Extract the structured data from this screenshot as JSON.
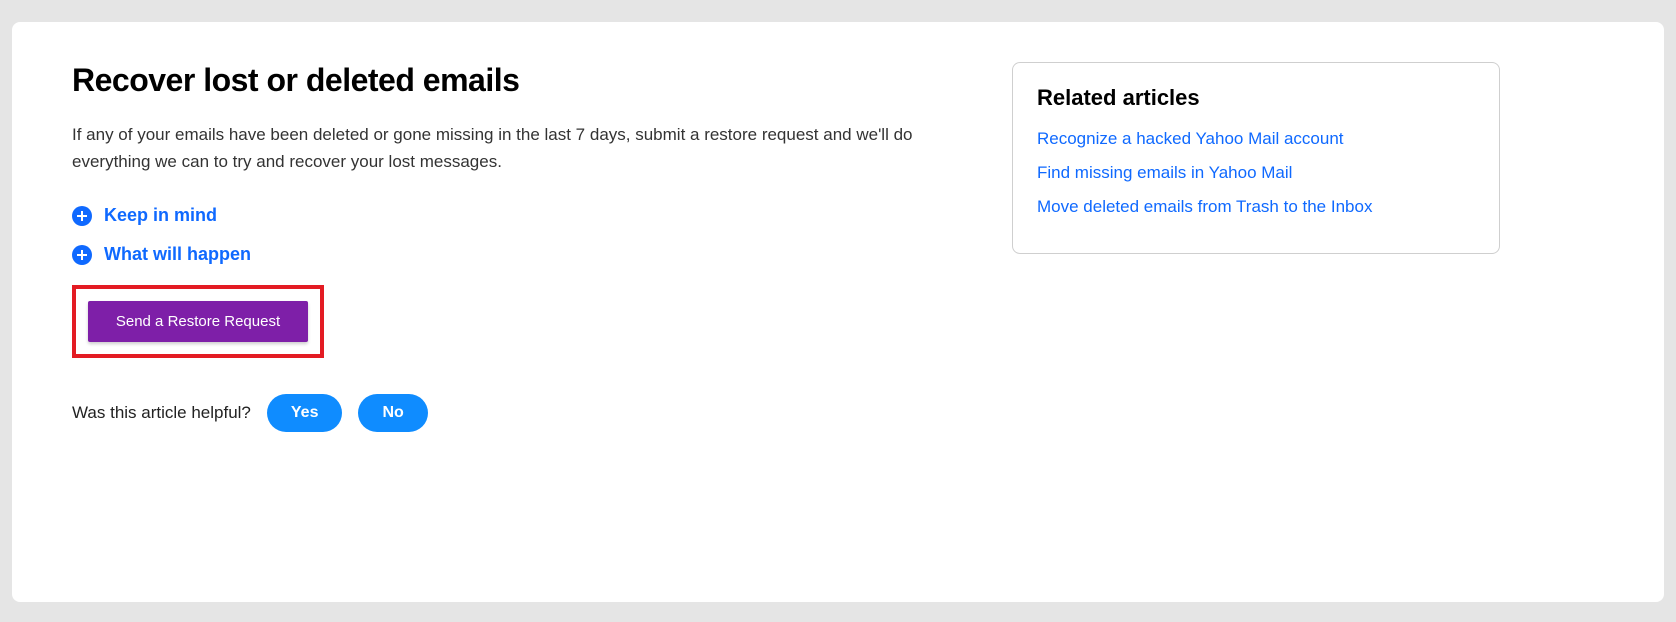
{
  "main": {
    "title": "Recover lost or deleted emails",
    "intro": "If any of your emails have been deleted or gone missing in the last 7 days, submit a restore request and we'll do everything we can to try and recover your lost messages.",
    "expanders": [
      {
        "label": "Keep in mind"
      },
      {
        "label": "What will happen"
      }
    ],
    "restore_button": "Send a Restore Request",
    "feedback_prompt": "Was this article helpful?",
    "yes_label": "Yes",
    "no_label": "No"
  },
  "sidebar": {
    "related_title": "Related articles",
    "links": [
      {
        "text": "Recognize a hacked Yahoo Mail account"
      },
      {
        "text": "Find missing emails in Yahoo Mail"
      },
      {
        "text": "Move deleted emails from Trash to the Inbox"
      }
    ]
  }
}
